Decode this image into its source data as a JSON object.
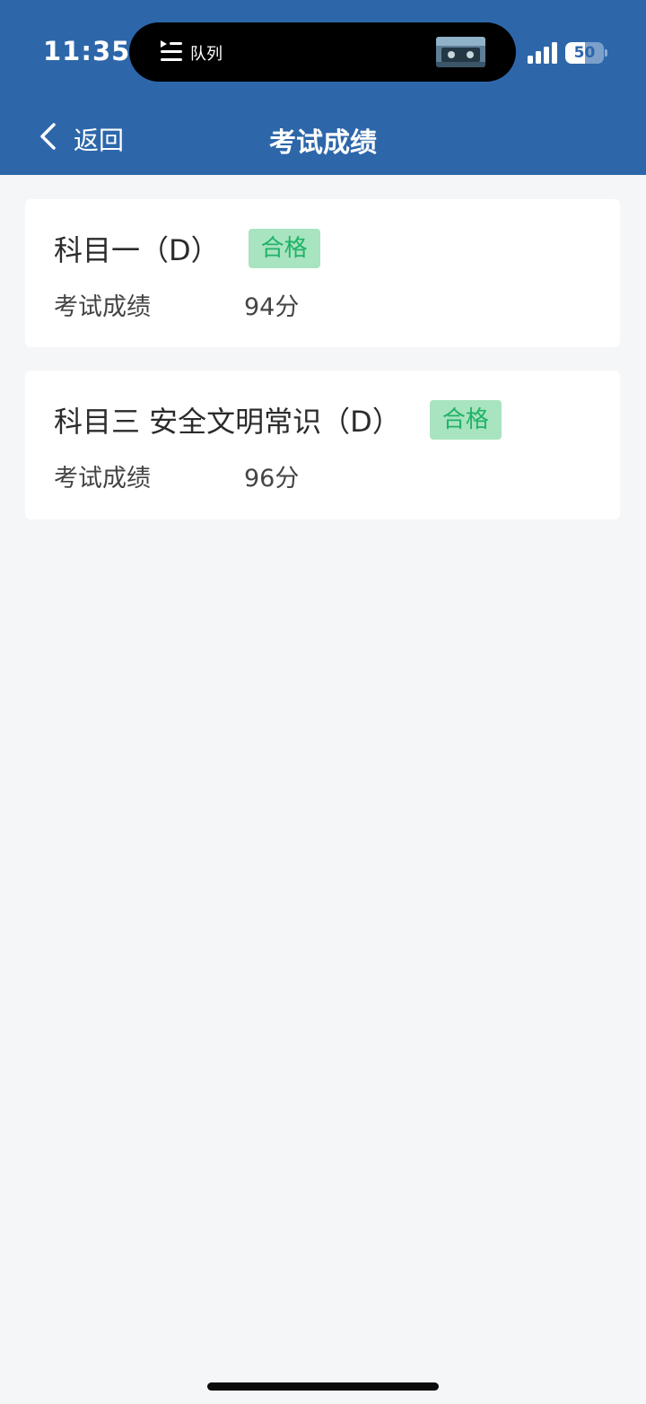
{
  "status_bar": {
    "time": "11:35",
    "now_playing_label": "队列",
    "battery_level": "50",
    "battery_fraction": 0.5
  },
  "nav": {
    "back_label": "返回",
    "title": "考试成绩"
  },
  "results": [
    {
      "subject": "科目一（D）",
      "status": "合格",
      "score_label": "考试成绩",
      "score": "94分"
    },
    {
      "subject": "科目三 安全文明常识（D）",
      "status": "合格",
      "score_label": "考试成绩",
      "score": "96分"
    }
  ],
  "colors": {
    "header_bg": "#2d67aa",
    "page_bg": "#f5f6f8",
    "pass_badge_bg": "#a8e4bf",
    "pass_badge_text": "#21b268"
  },
  "icons": [
    "queue-icon",
    "signal-icon",
    "battery-icon",
    "back-chevron-icon"
  ]
}
